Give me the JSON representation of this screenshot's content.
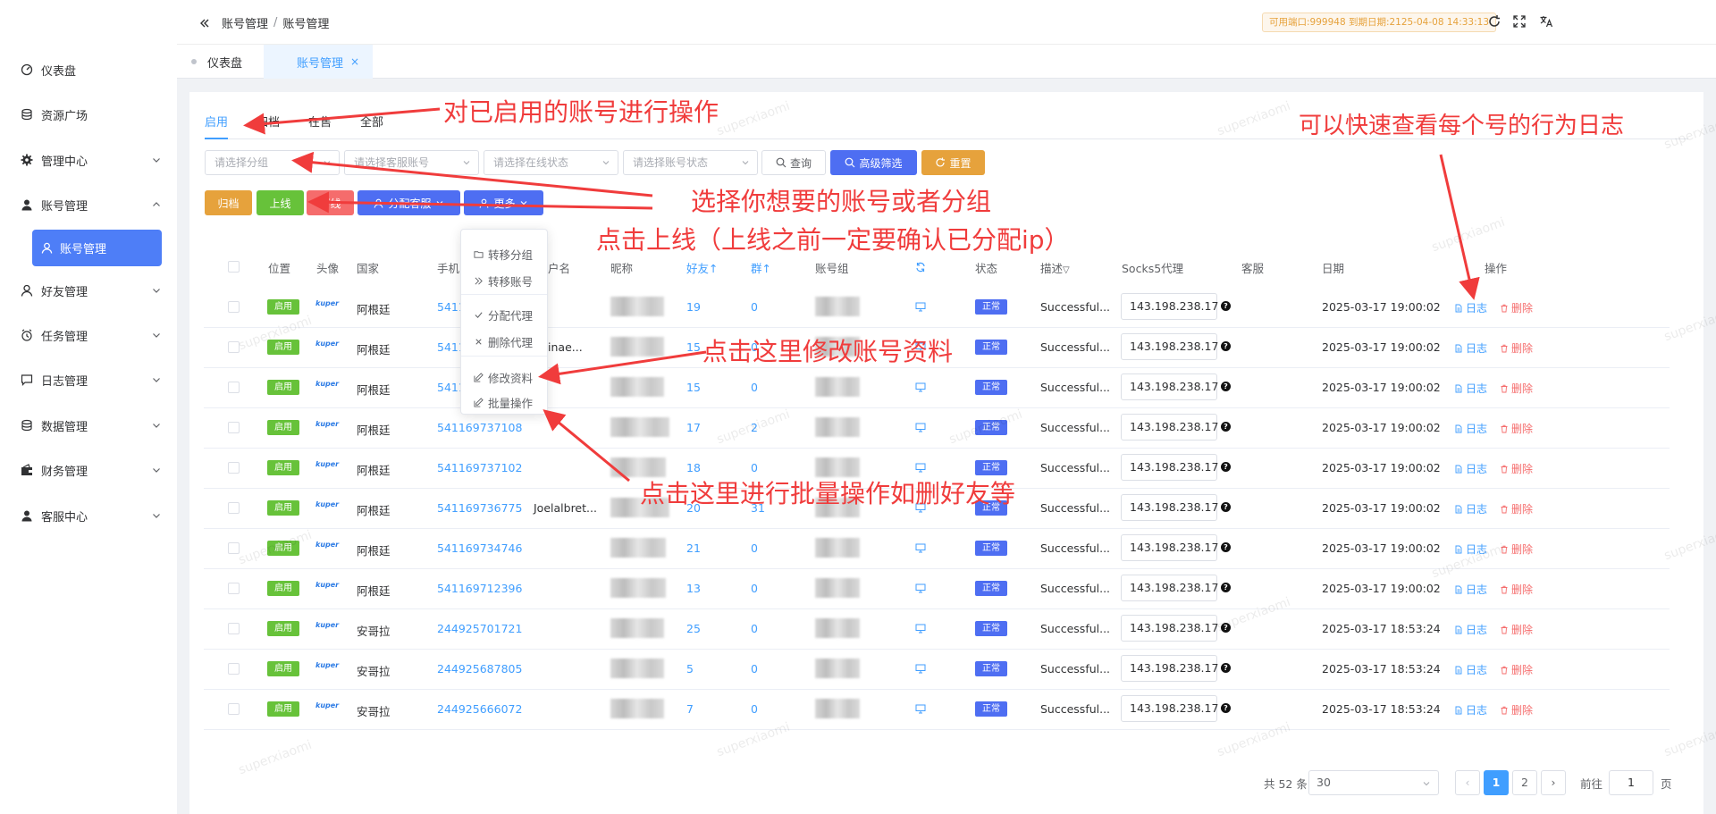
{
  "sidebar": {
    "items": [
      {
        "label": "仪表盘",
        "icon": "dashboard-icon",
        "has_chevron": false
      },
      {
        "label": "资源广场",
        "icon": "database-icon",
        "has_chevron": false
      },
      {
        "label": "管理中心",
        "icon": "gear-icon",
        "has_chevron": true
      },
      {
        "label": "账号管理",
        "icon": "user-icon",
        "has_chevron": true,
        "expanded": true
      },
      {
        "label": "好友管理",
        "icon": "user-outline-icon",
        "has_chevron": true
      },
      {
        "label": "任务管理",
        "icon": "alarm-clock-icon",
        "has_chevron": true
      },
      {
        "label": "日志管理",
        "icon": "message-icon",
        "has_chevron": true
      },
      {
        "label": "数据管理",
        "icon": "database-icon",
        "has_chevron": true
      },
      {
        "label": "财务管理",
        "icon": "wallet-icon",
        "has_chevron": true
      },
      {
        "label": "客服中心",
        "icon": "user-icon",
        "has_chevron": true
      }
    ],
    "active_sub": {
      "label": "账号管理",
      "icon": "user-outline-icon"
    }
  },
  "header": {
    "breadcrumb": [
      "账号管理",
      "账号管理"
    ],
    "breadcrumb_sep": "/",
    "expire_notice": "可用端口:999948 到期日期:2125-04-08 14:33:13"
  },
  "tabs": [
    {
      "label": "仪表盘",
      "active": false
    },
    {
      "label": "账号管理",
      "active": true,
      "close": "×"
    }
  ],
  "subtabs": [
    "启用",
    "归档",
    "在售",
    "全部"
  ],
  "filters": {
    "group_placeholder": "请选择分组",
    "service_placeholder": "请选择客服账号",
    "online_placeholder": "请选择在线状态",
    "status_placeholder": "请选择账号状态"
  },
  "buttons": {
    "query": "查询",
    "advanced": "高级筛选",
    "reset": "重置",
    "archive": "归档",
    "online": "上线",
    "offline": "下线",
    "assign_service": "分配客服",
    "more": "更多"
  },
  "dropdown": {
    "items": [
      {
        "label": "转移分组",
        "icon": "folder-icon"
      },
      {
        "label": "转移账号",
        "icon": "double-chevron-icon"
      },
      {
        "label": "分配代理",
        "icon": "check-icon"
      },
      {
        "label": "删除代理",
        "icon": "close-icon"
      },
      {
        "label": "修改资料",
        "icon": "edit-icon"
      },
      {
        "label": "批量操作",
        "icon": "edit-icon"
      }
    ]
  },
  "table": {
    "headers": {
      "location": "位置",
      "avatar": "头像",
      "country": "国家",
      "phone": "手机",
      "username": "户名",
      "nickname": "昵称",
      "friends": "好友",
      "groups": "群",
      "account_group": "账号组",
      "status": "状态",
      "desc": "描述",
      "proxy": "Socks5代理",
      "service": "客服",
      "date": "日期",
      "actions": "操作"
    },
    "rows": [
      {
        "loc": "启用",
        "avatar": "kuper",
        "country": "阿根廷",
        "phone": "5411",
        "username": "",
        "friends": "19",
        "groups": "0",
        "status": "正常",
        "desc": "Successful...",
        "proxy": "143.198.238.17",
        "date": "2025-03-17 19:00:02"
      },
      {
        "loc": "启用",
        "avatar": "kuper",
        "country": "阿根廷",
        "phone": "5411",
        "username": "talinae...",
        "friends": "15",
        "groups": "0",
        "status": "正常",
        "desc": "Successful...",
        "proxy": "143.198.238.17",
        "date": "2025-03-17 19:00:02"
      },
      {
        "loc": "启用",
        "avatar": "kuper",
        "country": "阿根廷",
        "phone": "5411",
        "username": "",
        "friends": "15",
        "groups": "0",
        "status": "正常",
        "desc": "Successful...",
        "proxy": "143.198.238.17",
        "date": "2025-03-17 19:00:02"
      },
      {
        "loc": "启用",
        "avatar": "kuper",
        "country": "阿根廷",
        "phone": "541169737108",
        "username": "",
        "friends": "17",
        "groups": "2",
        "status": "正常",
        "desc": "Successful...",
        "proxy": "143.198.238.17",
        "date": "2025-03-17 19:00:02"
      },
      {
        "loc": "启用",
        "avatar": "kuper",
        "country": "阿根廷",
        "phone": "541169737102",
        "username": "",
        "friends": "18",
        "groups": "0",
        "status": "正常",
        "desc": "Successful...",
        "proxy": "143.198.238.17",
        "date": "2025-03-17 19:00:02"
      },
      {
        "loc": "启用",
        "avatar": "kuper",
        "country": "阿根廷",
        "phone": "541169736775",
        "username": "Joelalbret...",
        "friends": "20",
        "groups": "31",
        "status": "正常",
        "desc": "Successful...",
        "proxy": "143.198.238.17",
        "date": "2025-03-17 19:00:02"
      },
      {
        "loc": "启用",
        "avatar": "kuper",
        "country": "阿根廷",
        "phone": "541169734746",
        "username": "",
        "friends": "21",
        "groups": "0",
        "status": "正常",
        "desc": "Successful...",
        "proxy": "143.198.238.17",
        "date": "2025-03-17 19:00:02"
      },
      {
        "loc": "启用",
        "avatar": "kuper",
        "country": "阿根廷",
        "phone": "541169712396",
        "username": "",
        "friends": "13",
        "groups": "0",
        "status": "正常",
        "desc": "Successful...",
        "proxy": "143.198.238.17",
        "date": "2025-03-17 19:00:02"
      },
      {
        "loc": "启用",
        "avatar": "kuper",
        "country": "安哥拉",
        "phone": "244925701721",
        "username": "",
        "friends": "25",
        "groups": "0",
        "status": "正常",
        "desc": "Successful...",
        "proxy": "143.198.238.17",
        "date": "2025-03-17 18:53:24"
      },
      {
        "loc": "启用",
        "avatar": "kuper",
        "country": "安哥拉",
        "phone": "244925687805",
        "username": "",
        "friends": "5",
        "groups": "0",
        "status": "正常",
        "desc": "Successful...",
        "proxy": "143.198.238.17",
        "date": "2025-03-17 18:53:24"
      },
      {
        "loc": "启用",
        "avatar": "kuper",
        "country": "安哥拉",
        "phone": "244925666072",
        "username": "",
        "friends": "7",
        "groups": "0",
        "status": "正常",
        "desc": "Successful...",
        "proxy": "143.198.238.17",
        "date": "2025-03-17 18:53:24"
      }
    ],
    "log_label": "日志",
    "delete_label": "删除"
  },
  "pagination": {
    "total": "共 52 条",
    "page_size": "30",
    "pages": [
      "1",
      "2"
    ],
    "current": "1",
    "goto_prefix": "前往",
    "goto_value": "1",
    "goto_suffix": "页"
  },
  "annotations": {
    "a1": "对已启用的账号进行操作",
    "a2": "可以快速查看每个号的行为日志",
    "a3": "选择你想要的账号或者分组",
    "a4": "点击上线（上线之前一定要确认已分配ip）",
    "a5": "点击这里修改账号资料",
    "a6": "点击这里进行批量操作如删好友等"
  },
  "watermark": "superxiaomi",
  "colors": {
    "primary": "#409eff",
    "success": "#67c23a",
    "danger": "#f56c6c",
    "warning": "#e6a23c",
    "annotation": "#f03c3c"
  }
}
